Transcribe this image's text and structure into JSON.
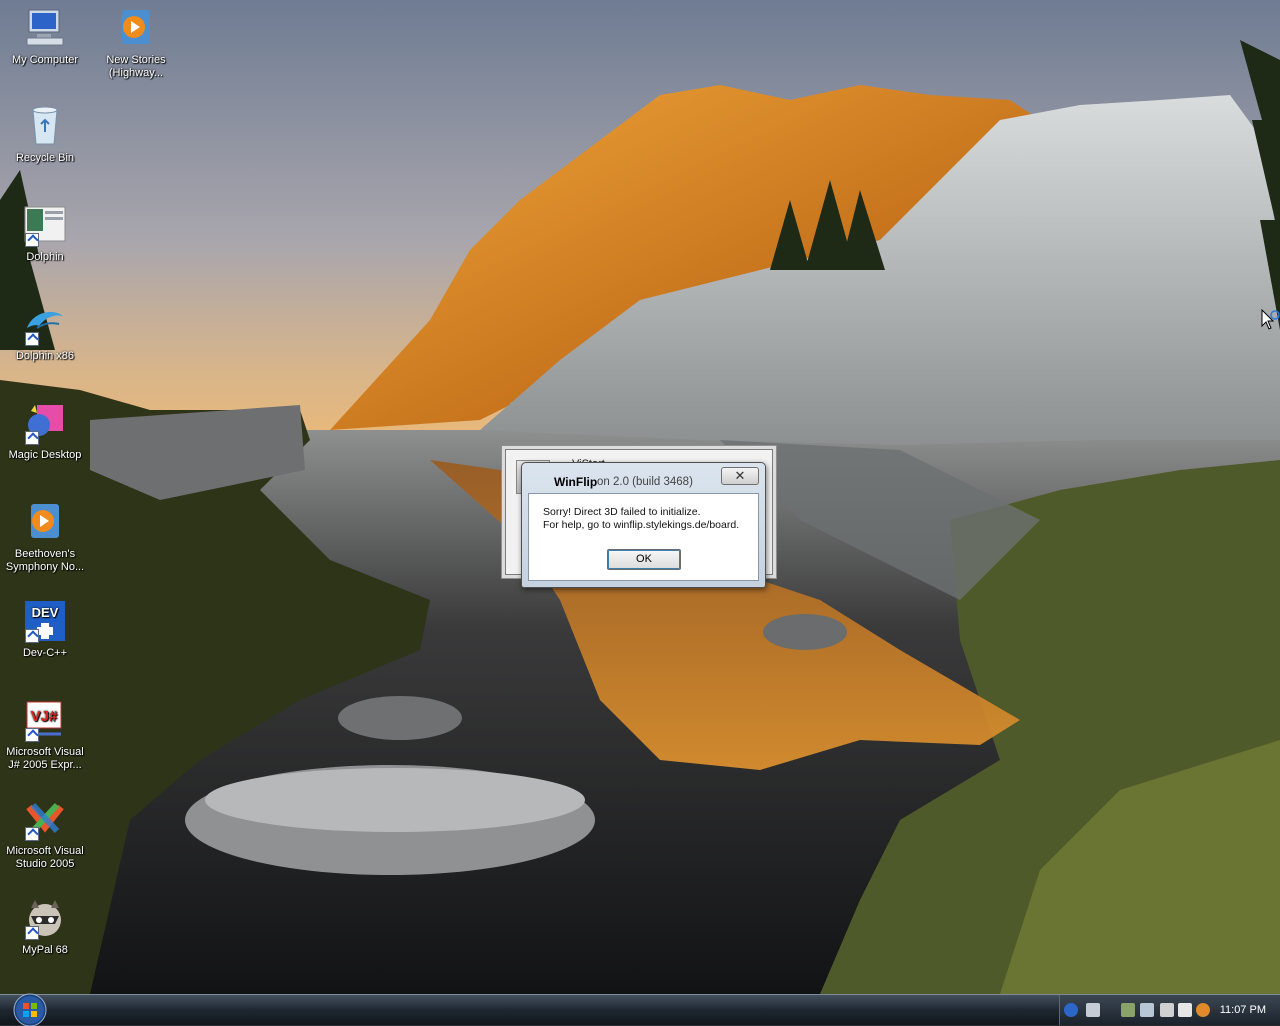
{
  "desktop": {
    "icons": [
      {
        "label": "My Computer"
      },
      {
        "label": "New Stories (Highway..."
      },
      {
        "label": "Recycle Bin"
      },
      {
        "label": "Dolphin"
      },
      {
        "label": "Dolphin x86"
      },
      {
        "label": "Magic Desktop"
      },
      {
        "label": "Beethoven's Symphony No..."
      },
      {
        "label": "Dev-C++"
      },
      {
        "label": "Microsoft Visual J# 2005 Expr..."
      },
      {
        "label": "Microsoft Visual Studio 2005"
      },
      {
        "label": "MyPal 68"
      }
    ]
  },
  "vistart_dialog": {
    "title": "ViStart"
  },
  "winflip_dialog": {
    "title": "WinFlip",
    "title_suffix": "on 2.0 (build 3468)",
    "message_line1": "Sorry! Direct 3D failed to initialize.",
    "message_line2": "For help, go to winflip.stylekings.de/board.",
    "ok_label": "OK",
    "close_glyph": "✕"
  },
  "taskbar": {
    "clock": "11:07 PM",
    "tray_icons": [
      "help-icon",
      "network-icon",
      "app-icon",
      "monitor-icon",
      "app-icon",
      "tl-icon",
      "search-icon"
    ]
  },
  "colors": {
    "taskbar": "#1e2730",
    "dialog_frame": "#c5d2e0",
    "sky_top": "#6f7c93",
    "sky_bottom": "#e9b97a",
    "mountain_lit": "#e79a2c",
    "rock": "#cfd2d3",
    "grass": "#4f5a2a",
    "water": "#1b1c1f"
  }
}
